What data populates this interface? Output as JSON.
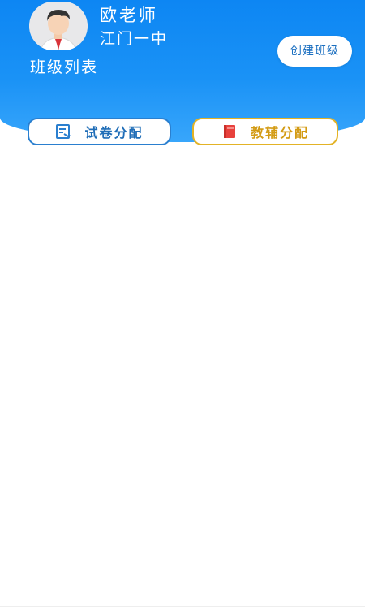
{
  "header": {
    "teacher_name": "欧老师",
    "school_name": "江门一中",
    "class_list_label": "班级列表",
    "create_class_label": "创建班级",
    "avatar_icon": "teacher-avatar-icon"
  },
  "actions": {
    "paper_assign_label": "试卷分配",
    "paper_assign_icon": "document-edit-icon",
    "aux_assign_label": "教辅分配",
    "aux_assign_icon": "red-book-icon"
  },
  "colors": {
    "header_blue": "#1a92f6",
    "paper_border": "#2a7fcf",
    "aux_border": "#e3b326"
  }
}
